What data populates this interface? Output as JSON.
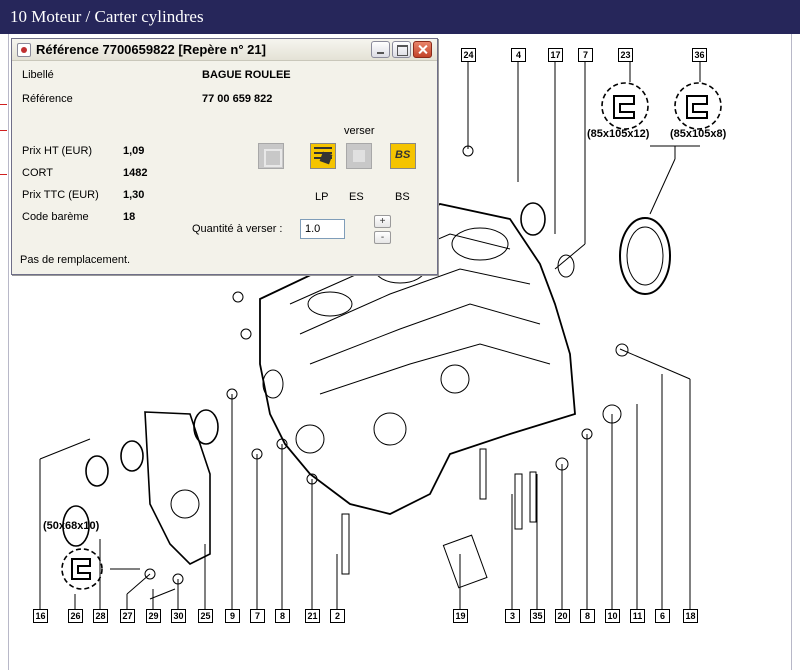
{
  "window": {
    "title": "10 Moteur / Carter cylindres"
  },
  "dialog": {
    "title": "Référence 7700659822 [Repère n° 21]",
    "fields": [
      {
        "label": "Libellé",
        "value": "BAGUE ROULEE"
      },
      {
        "label": "Référence",
        "value": "77 00 659 822"
      }
    ],
    "prices": [
      {
        "label": "Prix HT (EUR)",
        "value": "1,09"
      },
      {
        "label": "CORT",
        "value": "1482"
      },
      {
        "label": "Prix TTC (EUR)",
        "value": "1,30"
      },
      {
        "label": "Code barème",
        "value": "18"
      }
    ],
    "verser_label": "verser",
    "buttons": {
      "lp": "LP",
      "es": "ES",
      "bs": "BS"
    },
    "quantity_label": "Quantité à verser :",
    "quantity_value": "1.0",
    "plus_label": "+",
    "minus_label": "-",
    "status": "Pas de remplacement."
  },
  "diagram": {
    "top_callouts": [
      "24",
      "4",
      "17",
      "7",
      "23",
      "36"
    ],
    "bottom_callouts": [
      "16",
      "26",
      "28",
      "27",
      "29",
      "30",
      "25",
      "9",
      "7",
      "8",
      "21",
      "2",
      "19",
      "3",
      "35",
      "20",
      "8",
      "10",
      "11",
      "6",
      "18"
    ],
    "seal_labels": [
      "(85x105x12)",
      "(85x105x8)",
      "(50x68x10)"
    ]
  },
  "colors": {
    "title_bar": "#26265a",
    "button_yellow": "#f5c400",
    "close_red": "#c2432a"
  }
}
